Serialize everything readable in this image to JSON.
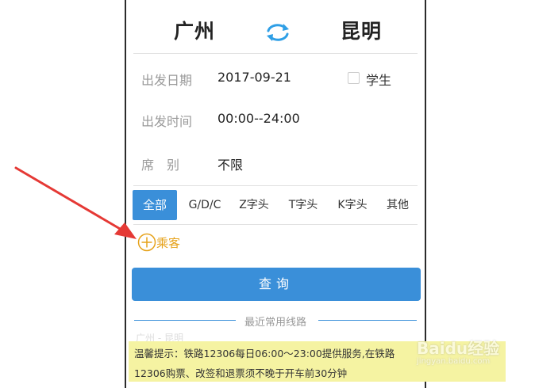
{
  "route": {
    "from_city": "广州",
    "to_city": "昆明",
    "swap_icon": "swap-arrows-icon"
  },
  "form": {
    "date_label": "出发日期",
    "date_value": "2017-09-21",
    "student_label": "学生",
    "student_checked": false,
    "time_label": "出发时间",
    "time_value": "00:00--24:00",
    "seat_label": "席　别",
    "seat_value": "不限"
  },
  "tabs": [
    {
      "label": "全部",
      "active": true
    },
    {
      "label": "G/D/C",
      "active": false
    },
    {
      "label": "Z字头",
      "active": false
    },
    {
      "label": "T字头",
      "active": false
    },
    {
      "label": "K字头",
      "active": false
    },
    {
      "label": "其他",
      "active": false
    }
  ],
  "passenger": {
    "label": "乘客",
    "icon": "plus-circle-icon"
  },
  "query": {
    "label": "查询"
  },
  "recent": {
    "label": "最近常用线路",
    "hint": "广州 - 昆明"
  },
  "notice": {
    "line1": "温馨提示：铁路12306每日06:00～23:00提供服务,在铁路",
    "line2": "12306购票、改签和退票须不晚于开车前30分钟"
  },
  "watermark": {
    "text": "Baidu经验",
    "sub": "jingyan.baidu.com"
  },
  "colors": {
    "accent": "#3a8fd9",
    "passenger": "#e6a21a",
    "notice_bg": "#f5f3a2",
    "arrow": "#e53935"
  }
}
